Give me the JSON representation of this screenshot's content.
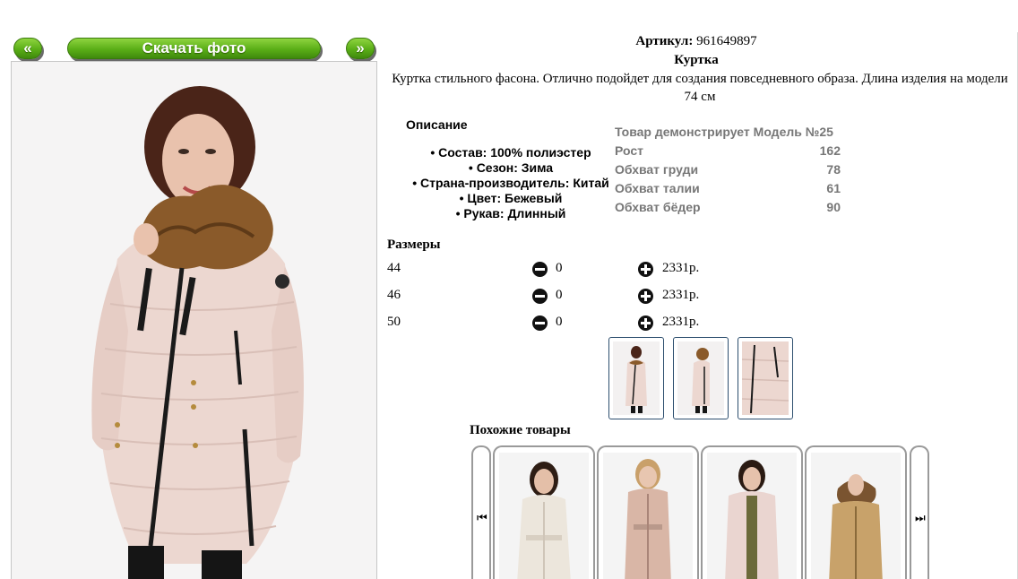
{
  "gallery": {
    "prev_label": "«",
    "download_label": "Скачать фото",
    "next_label": "»"
  },
  "product": {
    "article_label": "Артикул:",
    "article_value": "961649897",
    "title": "Куртка",
    "description": "Куртка стильного фасона. Отлично подойдет для создания повседневного образа. Длина изделия на модели 74 см",
    "description_head": "Описание",
    "properties": [
      "Состав: 100% полиэстер",
      "Сезон: Зима",
      "Страна-производитель: Китай",
      "Цвет: Бежевый",
      "Рукав: Длинный"
    ]
  },
  "model": {
    "heading": "Товар демонстрирует Модель №25",
    "rows": [
      {
        "label": "Рост",
        "value": "162"
      },
      {
        "label": "Обхват груди",
        "value": "78"
      },
      {
        "label": "Обхват талии",
        "value": "61"
      },
      {
        "label": "Обхват бёдер",
        "value": "90"
      }
    ]
  },
  "sizes": {
    "heading": "Размеры",
    "rows": [
      {
        "size": "44",
        "qty": "0",
        "price": "2331р."
      },
      {
        "size": "46",
        "qty": "0",
        "price": "2331р."
      },
      {
        "size": "50",
        "qty": "0",
        "price": "2331р."
      }
    ]
  },
  "similar": {
    "heading": "Похожие товары",
    "prev_glyph": "⏮",
    "next_glyph": "⏭"
  },
  "colors": {
    "button_green": "#5aae17",
    "jacket_pink": "#ecd7d0",
    "fur_brown": "#8a5a2a"
  }
}
